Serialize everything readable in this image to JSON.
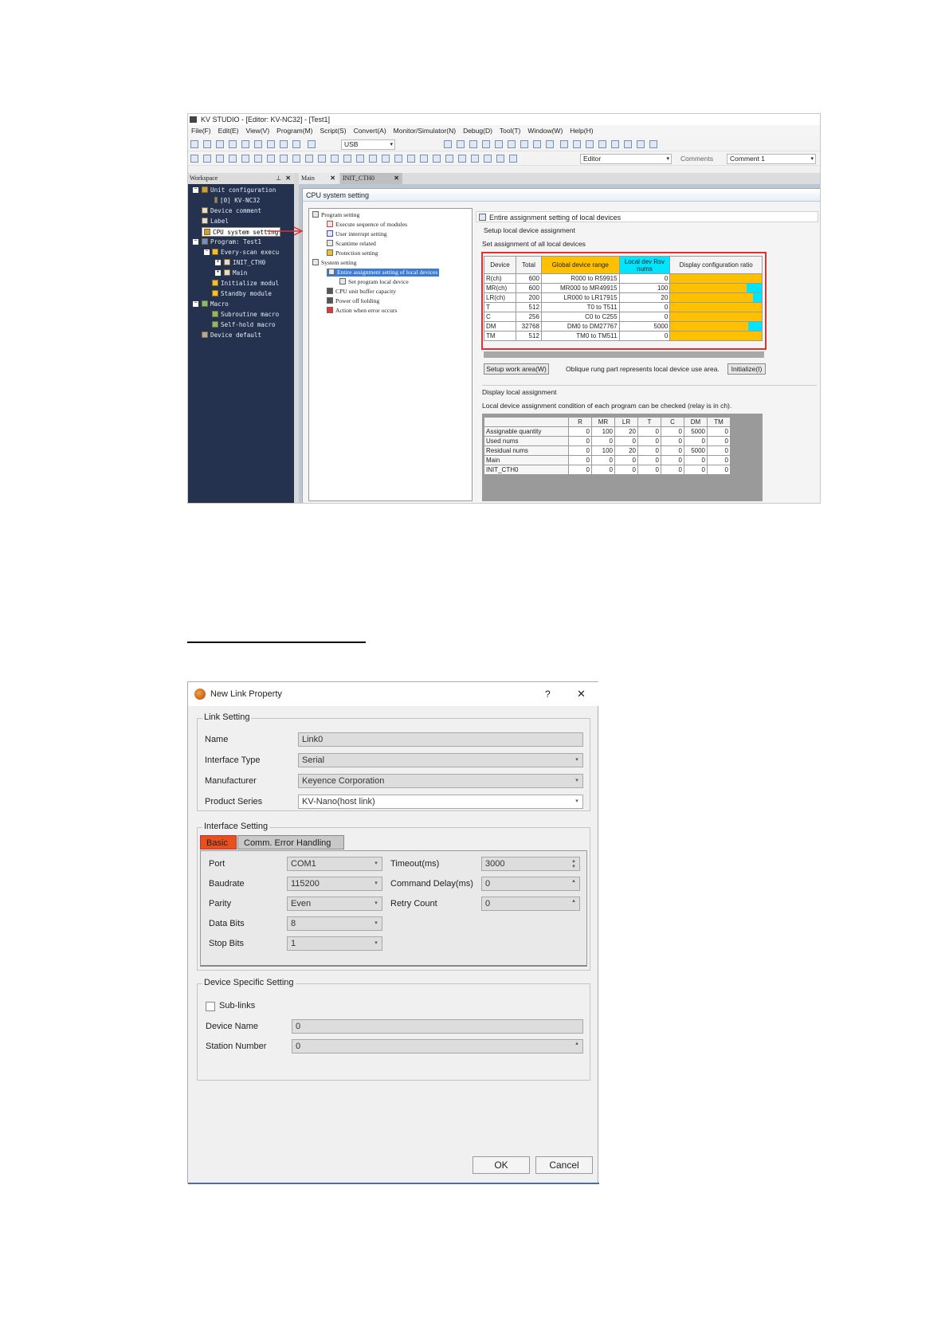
{
  "kv": {
    "title": "KV STUDIO - [Editor: KV-NC32] - [Test1]",
    "menu": [
      "File(F)",
      "Edit(E)",
      "View(V)",
      "Program(M)",
      "Script(S)",
      "Convert(A)",
      "Monitor/Simulator(N)",
      "Debug(D)",
      "Tool(T)",
      "Window(W)",
      "Help(H)"
    ],
    "toolbar": {
      "usb": "USB",
      "editor": "Editor",
      "comments_label": "Comments",
      "comment_value": "Comment 1"
    },
    "workspace": {
      "header": "Workspace",
      "items": [
        "Unit configuration",
        "[0]  KV-NC32",
        "Device comment",
        "Label",
        "CPU system setting",
        "Program: Test1",
        "Every-scan execu",
        "INIT_CTH0",
        "Main",
        "Initialize modul",
        "Standby module",
        "Macro",
        "Subroutine macro",
        "Self-hold macro",
        "Device default"
      ]
    },
    "tabs": [
      "Main",
      "INIT_CTH0"
    ],
    "cpu": {
      "header": "CPU system setting",
      "tree": [
        "Program setting",
        "Execute sequence of modules",
        "User interrupt setting",
        "Scantime related",
        "Protection setting",
        "System setting",
        "Entire assignment setting of local devices",
        "Set program local device",
        "CPU unit buffer capacity",
        "Power off holding",
        "Action when error occurs"
      ],
      "panel_title": "Entire assignment setting of local devices",
      "setup_label": "Setup local device assignment",
      "set_all_label": "Set assignment of all local devices",
      "loc_headers": [
        "Device",
        "Total",
        "Global device range",
        "Local dev Rsv nums",
        "Display configuration ratio"
      ],
      "loc_rows": [
        {
          "device": "R(ch)",
          "total": "600",
          "range": "R000 to R59915",
          "rsv": "0",
          "ratio": 0
        },
        {
          "device": "MR(ch)",
          "total": "600",
          "range": "MR000 to MR49915",
          "rsv": "100",
          "ratio": 0.17
        },
        {
          "device": "LR(ch)",
          "total": "200",
          "range": "LR000 to LR17915",
          "rsv": "20",
          "ratio": 0.1
        },
        {
          "device": "T",
          "total": "512",
          "range": "T0 to   T511",
          "rsv": "0",
          "ratio": 0
        },
        {
          "device": "C",
          "total": "256",
          "range": "C0 to   C255",
          "rsv": "0",
          "ratio": 0
        },
        {
          "device": "DM",
          "total": "32768",
          "range": "DM0 to DM27767",
          "rsv": "5000",
          "ratio": 0.15
        },
        {
          "device": "TM",
          "total": "512",
          "range": "TM0 to  TM511",
          "rsv": "0",
          "ratio": 0
        }
      ],
      "setup_work_btn": "Setup work area(W)",
      "oblique_note": "Oblique rung part represents local device use area.",
      "init_btn": "Initialize(I)",
      "display_label": "Display local assignment",
      "display_note": "Local device assignment condition of each program can be checked (relay is in ch).",
      "disp_headers": [
        "",
        "R",
        "MR",
        "LR",
        "T",
        "C",
        "DM",
        "TM"
      ],
      "disp_rows": [
        [
          "Assignable quantity",
          "0",
          "100",
          "20",
          "0",
          "0",
          "5000",
          "0"
        ],
        [
          "Used nums",
          "0",
          "0",
          "0",
          "0",
          "0",
          "0",
          "0"
        ],
        [
          "Residual nums",
          "0",
          "100",
          "20",
          "0",
          "0",
          "5000",
          "0"
        ],
        [
          "Main",
          "0",
          "0",
          "0",
          "0",
          "0",
          "0",
          "0"
        ],
        [
          "INIT_CTH0",
          "0",
          "0",
          "0",
          "0",
          "0",
          "0",
          "0"
        ]
      ]
    }
  },
  "dialog": {
    "title": "New Link Property",
    "help": "?",
    "close": "✕",
    "link_setting": {
      "label": "Link Setting",
      "name_label": "Name",
      "name_value": "Link0",
      "iface_label": "Interface Type",
      "iface_value": "Serial",
      "manu_label": "Manufacturer",
      "manu_value": "Keyence Corporation",
      "series_label": "Product Series",
      "series_value": "KV-Nano(host link)"
    },
    "iface_setting": {
      "label": "Interface Setting",
      "tab_basic": "Basic",
      "tab_error": "Comm. Error Handling",
      "port_label": "Port",
      "port_value": "COM1",
      "baud_label": "Baudrate",
      "baud_value": "115200",
      "parity_label": "Parity",
      "parity_value": "Even",
      "databits_label": "Data Bits",
      "databits_value": "8",
      "stopbits_label": "Stop Bits",
      "stopbits_value": "1",
      "timeout_label": "Timeout(ms)",
      "timeout_value": "3000",
      "cmddelay_label": "Command Delay(ms)",
      "cmddelay_value": "0",
      "retry_label": "Retry Count",
      "retry_value": "0"
    },
    "device_setting": {
      "label": "Device Specific Setting",
      "sublinks_label": "Sub-links",
      "devname_label": "Device Name",
      "devname_value": "0",
      "station_label": "Station Number",
      "station_value": "0"
    },
    "ok": "OK",
    "cancel": "Cancel"
  }
}
